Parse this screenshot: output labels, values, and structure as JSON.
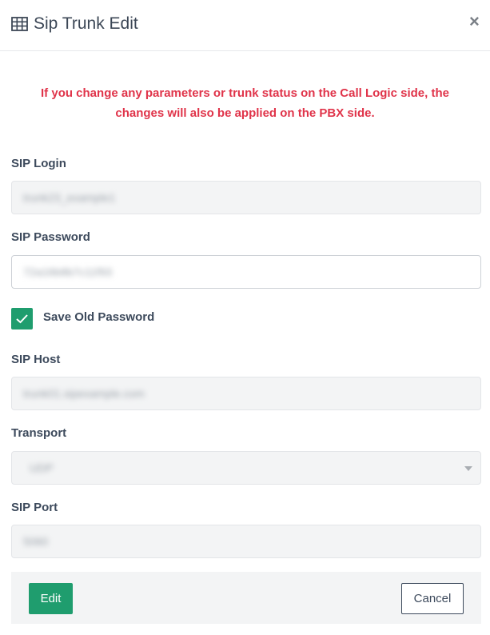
{
  "modal": {
    "title": "Sip Trunk Edit",
    "title_icon": "table-grid-icon",
    "close_label": "×"
  },
  "warning": {
    "line1": "If you change any parameters or trunk status on the Call Logic side, the",
    "line2": "changes will also be applied on the PBX side."
  },
  "form": {
    "sip_login": {
      "label": "SIP Login",
      "value": "trunk23_example1"
    },
    "sip_password": {
      "label": "SIP Password",
      "value": "72a16b8b7c11f93"
    },
    "save_old_password": {
      "label": "Save Old Password",
      "checked": true
    },
    "sip_host": {
      "label": "SIP Host",
      "value": "trunk01.sipexample.com"
    },
    "transport": {
      "label": "Transport",
      "value": "UDP"
    },
    "sip_port": {
      "label": "SIP Port",
      "value": "5060"
    }
  },
  "footer": {
    "edit_label": "Edit",
    "cancel_label": "Cancel"
  },
  "colors": {
    "accent": "#1f9d6e",
    "warning": "#e0344a",
    "text": "#3d4a5c",
    "disabled_bg": "#f3f4f5"
  }
}
